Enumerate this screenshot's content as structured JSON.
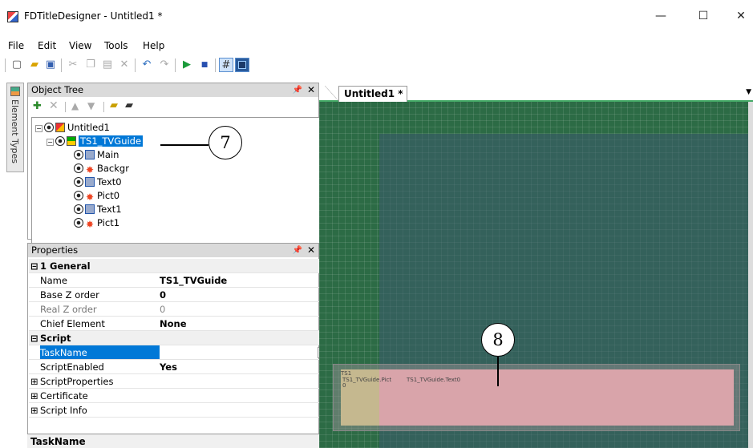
{
  "window": {
    "title": "FDTitleDesigner - Untitled1 *",
    "controls": [
      "—",
      "☐",
      "✕"
    ]
  },
  "menu": [
    "File",
    "Edit",
    "View",
    "Tools",
    "Help"
  ],
  "side_tab": {
    "label": "Element Types"
  },
  "object_tree": {
    "title": "Object Tree",
    "items": [
      {
        "label": "Untitled1",
        "icon": "model-icon"
      },
      {
        "label": "TS1_TVGuide",
        "icon": "tvguide-icon",
        "selected": true
      },
      {
        "label": "Main",
        "icon": "text-element-icon"
      },
      {
        "label": "Backgr",
        "icon": "picture-element-icon"
      },
      {
        "label": "Text0",
        "icon": "text-element-icon"
      },
      {
        "label": "Pict0",
        "icon": "picture-element-icon"
      },
      {
        "label": "Text1",
        "icon": "text-element-icon"
      },
      {
        "label": "Pict1",
        "icon": "picture-element-icon"
      }
    ]
  },
  "properties": {
    "title": "Properties",
    "rows": [
      {
        "type": "category",
        "name": "1 General"
      },
      {
        "type": "prop",
        "name": "Name",
        "value": "TS1_TVGuide"
      },
      {
        "type": "prop",
        "name": "Base Z order",
        "value": "0"
      },
      {
        "type": "prop",
        "name": "Real Z order",
        "value": "0",
        "disabled": true
      },
      {
        "type": "prop",
        "name": "Chief Element",
        "value": "None"
      },
      {
        "type": "category",
        "name": "Script"
      },
      {
        "type": "prop",
        "name": "TaskName",
        "value": "",
        "selected": true
      },
      {
        "type": "prop",
        "name": "ScriptEnabled",
        "value": "Yes"
      },
      {
        "type": "group",
        "name": "ScriptProperties"
      },
      {
        "type": "group",
        "name": "Certificate"
      },
      {
        "type": "group",
        "name": "Script Info"
      }
    ],
    "help_title": "TaskName"
  },
  "document": {
    "tab_label": "Untitled1 *",
    "element_labels": [
      "TS1_TVGuide.Pict",
      "TS1_TVGuide.Text0",
      "0",
      "TS1"
    ]
  },
  "callouts": [
    "7",
    "8"
  ]
}
